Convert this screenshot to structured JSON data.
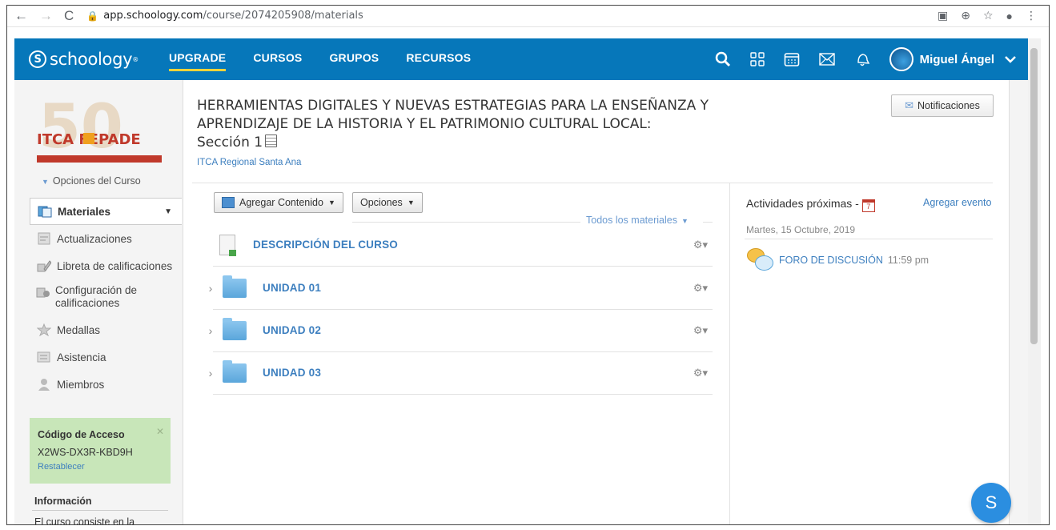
{
  "browser": {
    "url_host": "app.schoology.com",
    "url_path": "/course/2074205908/materials"
  },
  "header": {
    "logo": "schoology",
    "nav": [
      "UPGRADE",
      "CURSOS",
      "GRUPOS",
      "RECURSOS"
    ],
    "user_name": "Miguel Ángel"
  },
  "sidebar": {
    "logo_text": "ITCA FEPADE",
    "course_options": "Opciones del Curso",
    "items": [
      {
        "label": "Materiales",
        "icon": "materials-icon"
      },
      {
        "label": "Actualizaciones",
        "icon": "updates-icon"
      },
      {
        "label": "Libreta de calificaciones",
        "icon": "gradebook-icon"
      },
      {
        "label": "Configuración de calificaciones",
        "icon": "grade-settings-icon"
      },
      {
        "label": "Medallas",
        "icon": "badges-icon"
      },
      {
        "label": "Asistencia",
        "icon": "attendance-icon"
      },
      {
        "label": "Miembros",
        "icon": "members-icon"
      }
    ],
    "access_code": {
      "title": "Código de Acceso",
      "code": "X2WS-DX3R-KBD9H",
      "reset": "Restablecer"
    },
    "info_title": "Información",
    "info_text": "El curso consiste en la"
  },
  "course": {
    "title": "HERRAMIENTAS DIGITALES Y NUEVAS ESTRATEGIAS PARA LA ENSEÑANZA Y APRENDIZAJE DE LA HISTORIA Y EL PATRIMONIO CULTURAL LOCAL:",
    "section": "Sección 1",
    "organization": "ITCA Regional Santa Ana",
    "notifications_label": "Notificaciones"
  },
  "toolbar": {
    "add_content": "Agregar Contenido",
    "options": "Opciones",
    "filter": "Todos los materiales"
  },
  "materials": [
    {
      "title": "DESCRIPCIÓN DEL CURSO",
      "type": "document"
    },
    {
      "title": "UNIDAD 01",
      "type": "folder"
    },
    {
      "title": "UNIDAD 02",
      "type": "folder"
    },
    {
      "title": "UNIDAD 03",
      "type": "folder"
    }
  ],
  "upcoming": {
    "title": "Actividades próximas -",
    "add_event": "Agregar evento",
    "date": "Martes, 15 Octubre, 2019",
    "event_name": "FORO DE DISCUSIÓN",
    "event_time": "11:59 pm"
  },
  "chat_label": "S"
}
